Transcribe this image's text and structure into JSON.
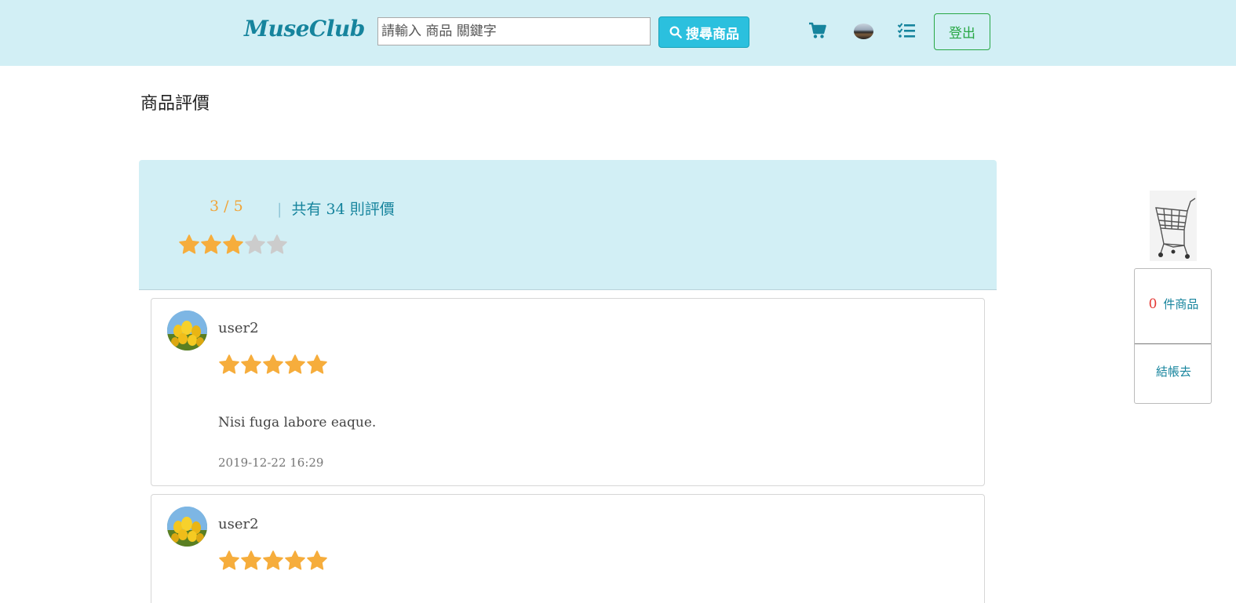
{
  "header": {
    "logo": "MuseClub",
    "search_placeholder": "請輸入 商品 關鍵字",
    "search_button": "搜尋商品",
    "logout_button": "登出"
  },
  "page": {
    "title": "商品評價"
  },
  "summary": {
    "score": "3 / 5",
    "separator": "|",
    "count_text": "共有 34 則評價",
    "rating": 3,
    "max_rating": 5
  },
  "reviews": [
    {
      "user": "user2",
      "rating": 5,
      "text": "Nisi fuga labore eaque.",
      "date": "2019-12-22 16:29"
    },
    {
      "user": "user2",
      "rating": 5,
      "text": "",
      "date": ""
    }
  ],
  "float_cart": {
    "count": "0",
    "count_label": "件商品",
    "checkout": "結帳去"
  },
  "colors": {
    "header_bg": "#d2eff5",
    "accent": "#16849d",
    "star_filled": "#f6ad3c",
    "star_empty": "#cccccc",
    "search_button": "#2bc0de",
    "logout": "#28a745"
  }
}
